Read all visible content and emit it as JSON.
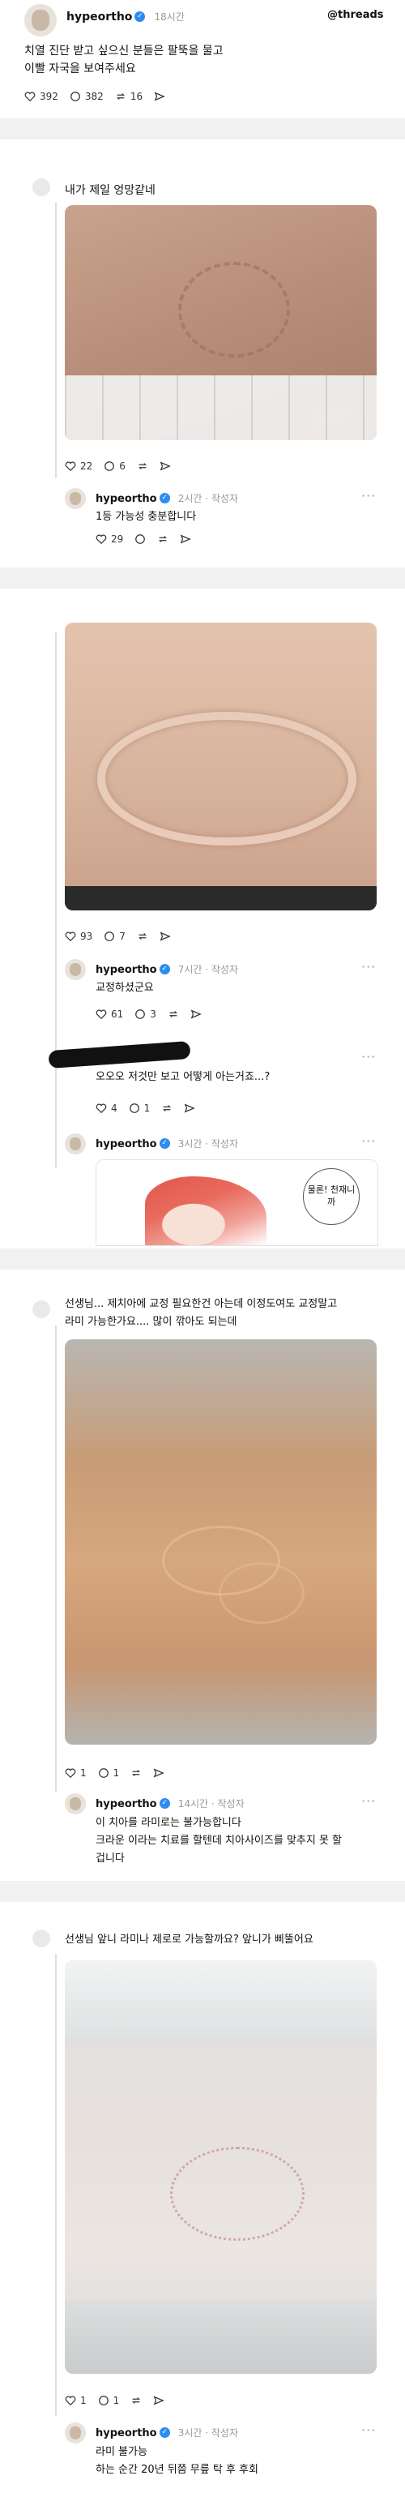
{
  "header": {
    "username": "hypeortho",
    "time": "18시간",
    "brand": "threads",
    "text_line1": "치열 진단 받고 싶으신 분들은 팔뚝을 물고",
    "text_line2": "이빨 자국을 보여주세요",
    "likes": "392",
    "comments": "382",
    "reposts": "16"
  },
  "post1": {
    "text": "내가 제일 엉망같네",
    "likes": "22",
    "comments": "6",
    "reply": {
      "username": "hypeortho",
      "time": "2시간",
      "author_tag": "작성자",
      "text": "1등 가능성 충분합니다",
      "likes": "29"
    }
  },
  "post2": {
    "likes": "93",
    "comments": "7",
    "reply1": {
      "username": "hypeortho",
      "time": "7시간",
      "author_tag": "작성자",
      "text": "교정하셨군요",
      "likes": "61",
      "comments": "3"
    },
    "reply2": {
      "text": "오오오 저것만 보고 어떻게 아는거죠...?",
      "likes": "4",
      "comments": "1"
    },
    "reply3": {
      "username": "hypeortho",
      "time": "3시간",
      "author_tag": "작성자",
      "manga_bubble": "물론! 천재니까"
    }
  },
  "post3": {
    "text_line1": "선생님... 제치아에 교정 필요한건 아는데 이정도여도 교정말고",
    "text_line2": "라미 가능한가요.... 많이 깎아도 되는데",
    "likes": "1",
    "comments": "1",
    "reply": {
      "username": "hypeortho",
      "time": "14시간",
      "author_tag": "작성자",
      "text_line1": "이 치아를 라미로는 불가능합니다",
      "text_line2": "크라운 이라는 치료를 할텐데 치아사이즈를 맞추지 못 할",
      "text_line3": "겁니다"
    }
  },
  "post4": {
    "text": "선생님 앞니 라미나 제로로 가능할까요? 앞니가 삐뚤어요",
    "likes": "1",
    "comments": "1",
    "reply": {
      "username": "hypeortho",
      "time": "3시간",
      "author_tag": "작성자",
      "text_line1": "라미 불가능",
      "text_line2": "하는 순간 20년 뒤쯤 무릎 탁 후 후회"
    }
  }
}
